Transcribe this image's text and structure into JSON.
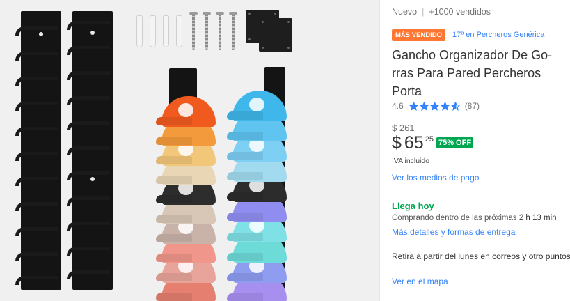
{
  "product": {
    "condition": "Nuevo",
    "sold": "+1000 vendidos",
    "bestseller_badge": "MÁS VENDIDO",
    "ranking": "17º en Percheros Genérica",
    "title": "Gancho Organizador De Go-rras Para Pared Percheros Porta",
    "rating": {
      "score": "4.6",
      "stars_value": 4.6,
      "stars_max": 5,
      "count": "(87)"
    },
    "price": {
      "original": "$ 261",
      "currency": "$",
      "integer": "65",
      "cents": "25",
      "discount": "75% OFF",
      "tax_note": "IVA incluido"
    },
    "payment_link": "Ver los medios de pago",
    "shipping": {
      "title": "Llega hoy",
      "subtitle_prefix": "Comprando dentro de las próximas",
      "time_left": "2 h 13 min",
      "details_link": "Más detalles y formas de entrega"
    },
    "pickup": {
      "text": "Retira a partir del lunes en correos y otro puntos",
      "map_link": "Ver en el mapa"
    }
  },
  "colors": {
    "accent_blue": "#3483fa",
    "success_green": "#00a650",
    "bestseller_orange": "#ff7733"
  },
  "images": {
    "cap_colors_left": [
      "#f05a1f",
      "#f39b3c",
      "#f2c77a",
      "#e9d6b5",
      "#2d2d2d",
      "#d8c7b6",
      "#c9b3a8",
      "#f0968a",
      "#e8a49a",
      "#e57f6f"
    ],
    "cap_colors_right": [
      "#3fb7ea",
      "#5fc4f0",
      "#7dcff3",
      "#a2dbef",
      "#2c2c2c",
      "#8f8ef0",
      "#7fe0e6",
      "#6ddbd8",
      "#8e9df0",
      "#a78ff0"
    ]
  }
}
